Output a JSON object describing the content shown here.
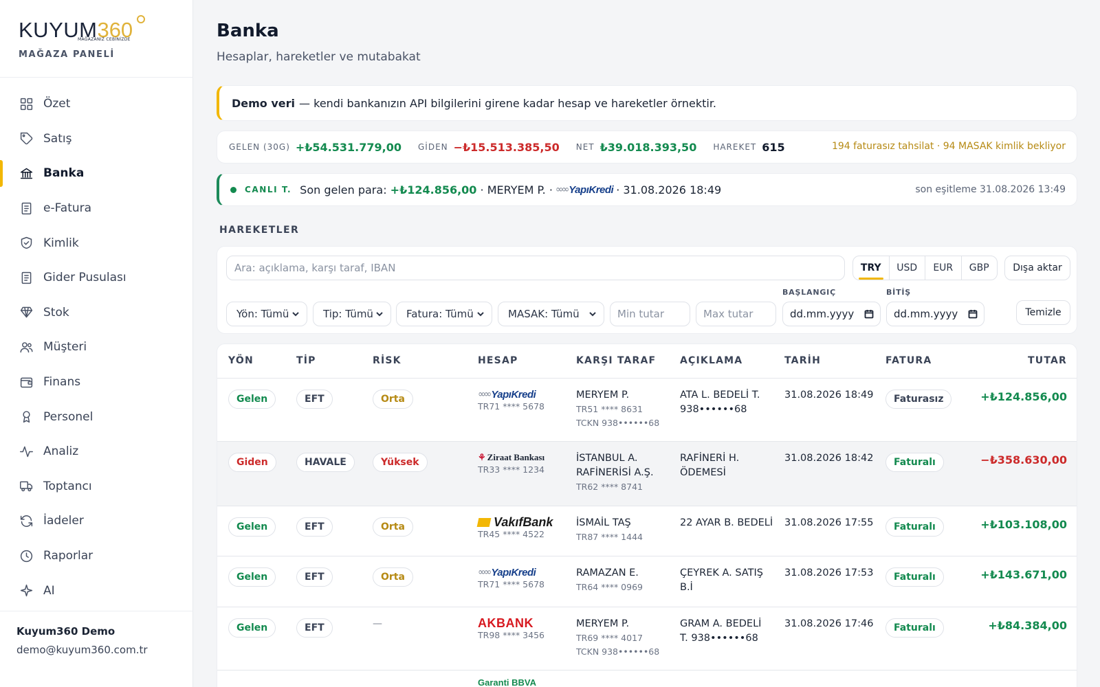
{
  "brand": {
    "word": "KUYUM",
    "num": "360",
    "tagline": "MAĞAZANIZ CEBİNİZDE",
    "subtitle": "MAĞAZA PANELİ"
  },
  "sidebar": {
    "items": [
      {
        "label": "Özet",
        "icon": "grid-icon"
      },
      {
        "label": "Satış",
        "icon": "tag-icon"
      },
      {
        "label": "Banka",
        "icon": "bank-icon",
        "active": true
      },
      {
        "label": "e-Fatura",
        "icon": "receipt-icon"
      },
      {
        "label": "Kimlik",
        "icon": "shield-check-icon"
      },
      {
        "label": "Gider Pusulası",
        "icon": "receipt-icon"
      },
      {
        "label": "Stok",
        "icon": "diamond-icon"
      },
      {
        "label": "Müşteri",
        "icon": "users-icon"
      },
      {
        "label": "Finans",
        "icon": "wallet-icon"
      },
      {
        "label": "Personel",
        "icon": "award-icon"
      },
      {
        "label": "Analiz",
        "icon": "activity-icon"
      },
      {
        "label": "Toptancı",
        "icon": "truck-icon"
      },
      {
        "label": "İadeler",
        "icon": "refresh-icon"
      },
      {
        "label": "Raporlar",
        "icon": "clock-icon"
      },
      {
        "label": "AI",
        "icon": "sparkle-icon"
      }
    ],
    "user_name": "Kuyum360 Demo",
    "user_email": "demo@kuyum360.com.tr"
  },
  "page": {
    "title": "Banka",
    "subtitle": "Hesaplar, hareketler ve mutabakat"
  },
  "notice": {
    "bold": "Demo veri",
    "text": "— kendi bankanızın API bilgilerini girene kadar hesap ve hareketler örnektir."
  },
  "stats": {
    "in_label": "GELEN (30G)",
    "in_value": "+₺54.531.779,00",
    "out_label": "GİDEN",
    "out_value": "−₺15.513.385,50",
    "net_label": "NET",
    "net_value": "₺39.018.393,50",
    "count_label": "HAREKET",
    "count_value": "615",
    "right": "194 faturasız tahsilat · 94 MASAK kimlik bekliyor"
  },
  "live": {
    "tag": "CANLI T.",
    "prefix": "Son gelen para:",
    "amount": "+₺124.856,00",
    "who": "· MERYEM P. ·",
    "bank": "YapıKredi",
    "time": "· 31.08.2026 18:49",
    "right": "son eşitleme 31.08.2026 13:49"
  },
  "section_title": "HAREKETLER",
  "filters": {
    "search_placeholder": "Ara: açıklama, karşı taraf, IBAN",
    "currencies": [
      "TRY",
      "USD",
      "EUR",
      "GBP"
    ],
    "active_currency": "TRY",
    "export": "Dışa aktar",
    "direction": "Yön: Tümü",
    "type": "Tip: Tümü",
    "invoice": "Fatura: Tümü",
    "masak": "MASAK: Tümü",
    "min_placeholder": "Min tutar",
    "max_placeholder": "Max tutar",
    "start_label": "BAŞLANGIÇ",
    "end_label": "BİTİŞ",
    "date_placeholder": "dd.mm.yyyy",
    "clear": "Temizle"
  },
  "table": {
    "headers": [
      "YÖN",
      "TİP",
      "RİSK",
      "HESAP",
      "KARŞI TARAF",
      "AÇIKLAMA",
      "TARİH",
      "FATURA",
      "TUTAR"
    ],
    "rows": [
      {
        "dir": "Gelen",
        "type": "EFT",
        "risk": "Orta",
        "bank": "YapıKredi",
        "iban": "TR71 **** 5678",
        "party": "MERYEM P.",
        "party_iban": "TR51 **** 8631",
        "party_id": "TCKN 938••••••68",
        "desc": [
          "ATA L. BEDELİ T.",
          "938••••••68"
        ],
        "date": "31.08.2026 18:49",
        "invoice": "Faturasız",
        "amount": "+₺124.856,00"
      },
      {
        "dir": "Giden",
        "type": "HAVALE",
        "risk": "Yüksek",
        "bank": "Ziraat Bankası",
        "iban": "TR33 **** 1234",
        "party": [
          "İSTANBUL A.",
          "RAFİNERİSİ A.Ş."
        ],
        "party_iban": "TR62 **** 8741",
        "desc": [
          "RAFİNERİ H.",
          "ÖDEMESİ"
        ],
        "date": "31.08.2026 18:42",
        "invoice": "Faturalı",
        "amount": "−₺358.630,00"
      },
      {
        "dir": "Gelen",
        "type": "EFT",
        "risk": "Orta",
        "bank": "VakıfBank",
        "iban": "TR45 **** 4522",
        "party": "İSMAİL TAŞ",
        "party_iban": "TR87 **** 1444",
        "desc": [
          "22 AYAR B. BEDELİ"
        ],
        "date": "31.08.2026 17:55",
        "invoice": "Faturalı",
        "amount": "+₺103.108,00"
      },
      {
        "dir": "Gelen",
        "type": "EFT",
        "risk": "Orta",
        "bank": "YapıKredi",
        "iban": "TR71 **** 5678",
        "party": "RAMAZAN E.",
        "party_iban": "TR64 **** 0969",
        "desc": [
          "ÇEYREK A. SATIŞ",
          "B.İ"
        ],
        "date": "31.08.2026 17:53",
        "invoice": "Faturalı",
        "amount": "+₺143.671,00"
      },
      {
        "dir": "Gelen",
        "type": "EFT",
        "risk": "—",
        "bank": "AKBANK",
        "iban": "TR98 **** 3456",
        "party": "MERYEM P.",
        "party_iban": "TR69 **** 4017",
        "party_id": "TCKN 938••••••68",
        "desc": [
          "GRAM A. BEDELİ",
          "T. 938••••••68"
        ],
        "date": "31.08.2026 17:46",
        "invoice": "Faturalı",
        "amount": "+₺84.384,00"
      },
      {
        "bank": "Garanti BBVA"
      }
    ]
  },
  "colors": {
    "accent": "#f2b705",
    "positive": "#138a4f",
    "negative": "#cc2a2a",
    "warning": "#b68a14"
  }
}
